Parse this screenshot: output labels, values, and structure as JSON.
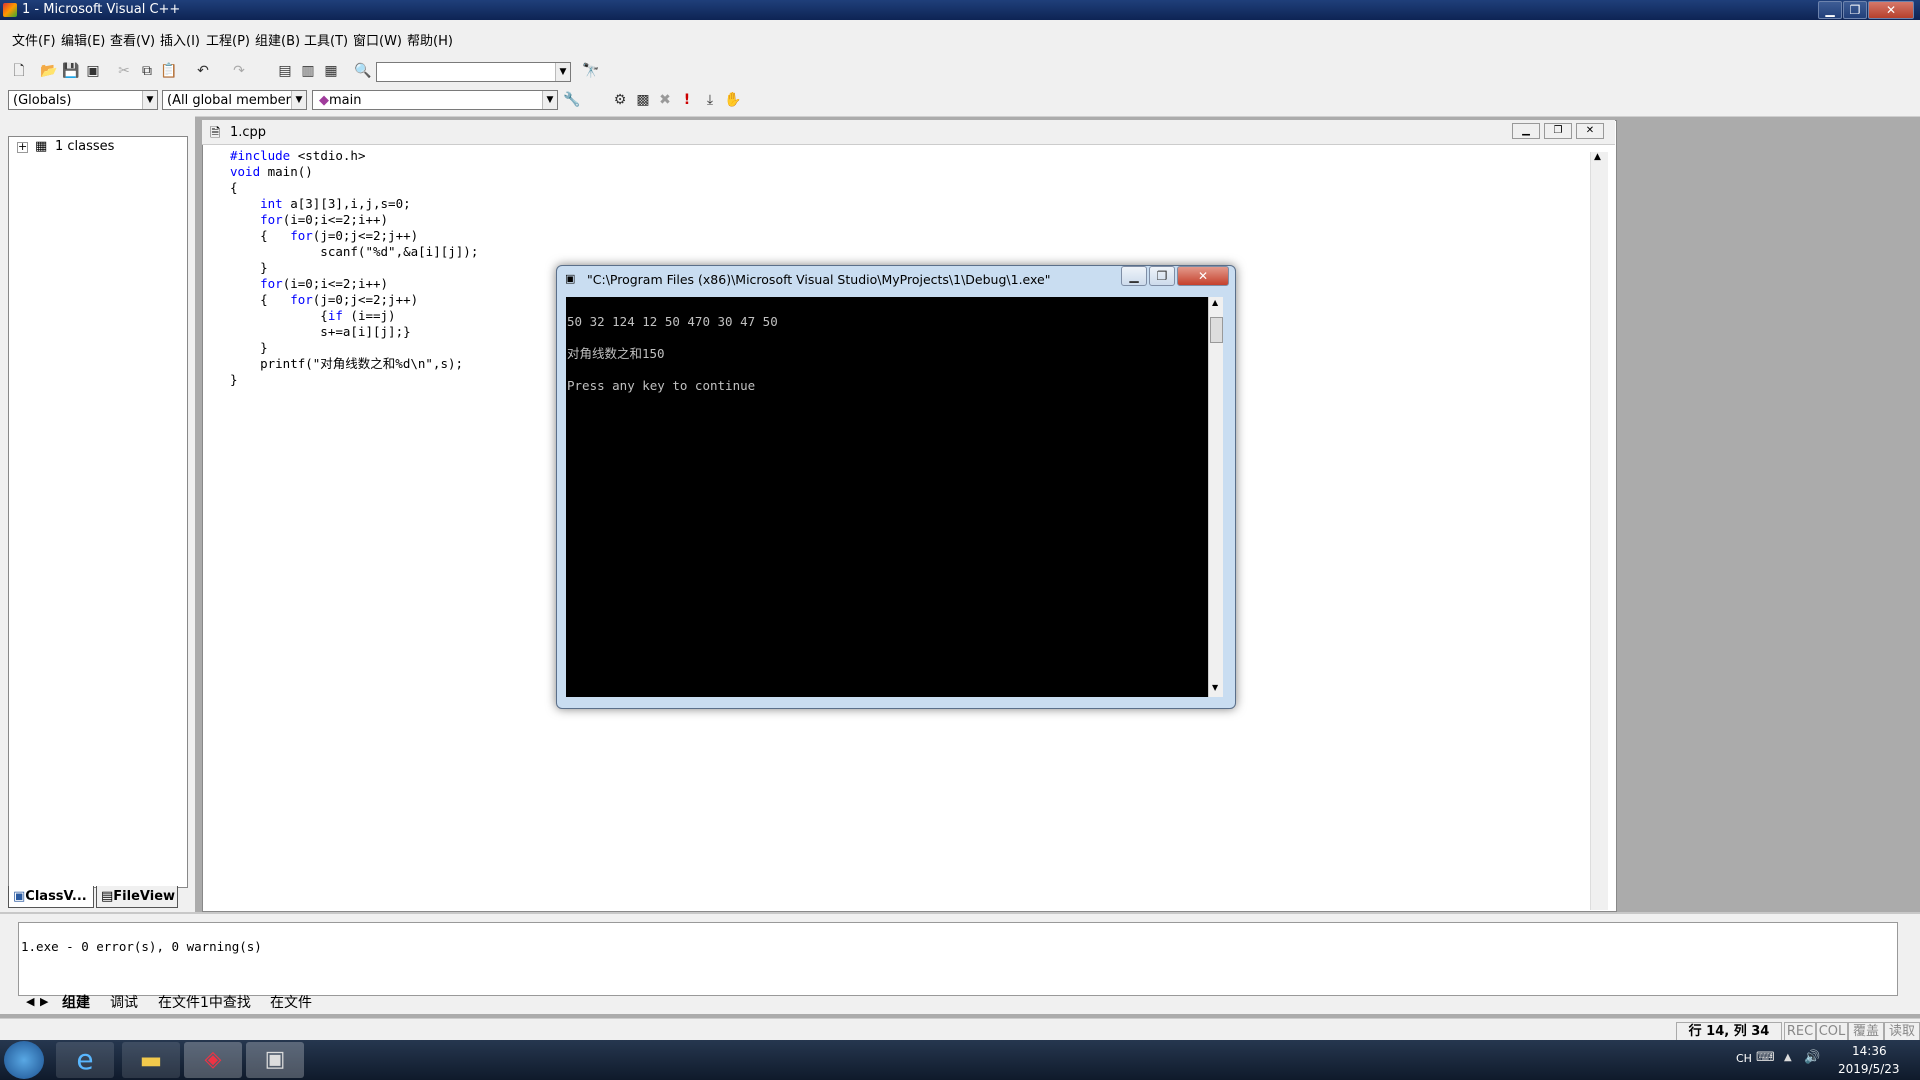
{
  "window": {
    "title": "1 - Microsoft Visual C++"
  },
  "menu": [
    "文件(F)",
    "编辑(E)",
    "查看(V)",
    "插入(I)",
    "工程(P)",
    "组建(B)",
    "工具(T)",
    "窗口(W)",
    "帮助(H)"
  ],
  "wizard_bar": {
    "class_combo": "(Globals)",
    "filter_combo": "(All global members",
    "member_combo": "main"
  },
  "workspace": {
    "tree_root": "1 classes",
    "tabs": [
      "ClassV...",
      "FileView"
    ]
  },
  "editor": {
    "file_tab": "1.cpp",
    "code": [
      "#include <stdio.h>",
      "void main()",
      "{",
      "    int a[3][3],i,j,s=0;",
      "    for(i=0;i<=2;i++)",
      "    {   for(j=0;j<=2;j++)",
      "            scanf(\"%d\",&a[i][j]);",
      "    }",
      "    for(i=0;i<=2;i++)",
      "    {   for(j=0;j<=2;j++)",
      "            {if (i==j)",
      "            s+=a[i][j];}",
      "    }",
      "    printf(\"对角线数之和%d\\n\",s);",
      "}"
    ]
  },
  "console": {
    "title": "\"C:\\Program Files (x86)\\Microsoft Visual Studio\\MyProjects\\1\\Debug\\1.exe\"",
    "lines": [
      "50 32 124 12 50 470 30 47 50",
      "对角线数之和150",
      "Press any key to continue"
    ]
  },
  "output": {
    "message": "1.exe - 0 error(s), 0 warning(s)",
    "tabs": [
      "组建",
      "调试",
      "在文件1中查找",
      "在文件"
    ]
  },
  "status": {
    "position": "行 14, 列 34",
    "indicators": [
      "REC",
      "COL",
      "覆盖",
      "读取"
    ]
  },
  "taskbar": {
    "lang": "CH",
    "time": "14:36",
    "date": "2019/5/23"
  }
}
